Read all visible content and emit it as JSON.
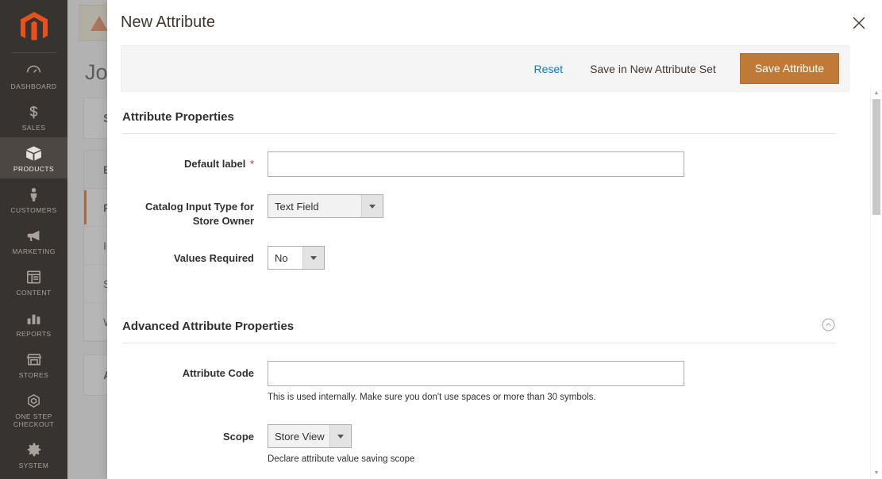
{
  "sidebar": {
    "logo_name": "magento-logo",
    "items": [
      {
        "label": "DASHBOARD",
        "icon": "dashboard-icon",
        "active": false
      },
      {
        "label": "SALES",
        "icon": "dollar-icon",
        "active": false
      },
      {
        "label": "PRODUCTS",
        "icon": "box-icon",
        "active": true
      },
      {
        "label": "CUSTOMERS",
        "icon": "person-icon",
        "active": false
      },
      {
        "label": "MARKETING",
        "icon": "megaphone-icon",
        "active": false
      },
      {
        "label": "CONTENT",
        "icon": "page-layout-icon",
        "active": false
      },
      {
        "label": "REPORTS",
        "icon": "bar-chart-icon",
        "active": false
      },
      {
        "label": "STORES",
        "icon": "storefront-icon",
        "active": false
      },
      {
        "label": "ONE STEP CHECKOUT",
        "icon": "hexagon-icon",
        "active": false
      },
      {
        "label": "SYSTEM",
        "icon": "gear-icon",
        "active": false
      }
    ]
  },
  "background_page": {
    "title": "Jou",
    "banner_icon": "warning-triangle-icon",
    "card_label": "St",
    "accordion_header": "BA",
    "accordion_rows": [
      {
        "label": "P",
        "selected": true
      },
      {
        "label": "In",
        "selected": false
      },
      {
        "label": "S",
        "selected": false
      },
      {
        "label": "W",
        "selected": false
      }
    ],
    "footer_card": "Al"
  },
  "modal": {
    "title": "New Attribute",
    "close_icon": "close-icon",
    "toolbar": {
      "reset_label": "Reset",
      "save_new_set_label": "Save in New Attribute Set",
      "save_label": "Save Attribute"
    },
    "sections": [
      {
        "legend": "Attribute Properties",
        "collapsible": false,
        "fields": [
          {
            "label": "Default label",
            "required": true,
            "control": "text",
            "value": "",
            "placeholder": "",
            "note": ""
          },
          {
            "label": "Catalog Input Type for Store Owner",
            "required": false,
            "control": "select",
            "value": "Text Field",
            "shaded": true,
            "note": ""
          },
          {
            "label": "Values Required",
            "required": false,
            "control": "select",
            "value": "No",
            "shaded": false,
            "note": ""
          }
        ]
      },
      {
        "legend": "Advanced Attribute Properties",
        "collapsible": true,
        "collapse_icon": "chevron-up-circle-icon",
        "fields": [
          {
            "label": "Attribute Code",
            "required": false,
            "control": "text",
            "value": "",
            "placeholder": "",
            "note": "This is used internally. Make sure you don't use spaces or more than 30 symbols."
          },
          {
            "label": "Scope",
            "required": false,
            "control": "select",
            "value": "Store View",
            "shaded": true,
            "note": "Declare attribute value saving scope"
          }
        ]
      }
    ],
    "scrollbar": {
      "up_arrow": "▲",
      "down_arrow": "▼"
    }
  },
  "colors": {
    "accent_orange": "#c07a38",
    "link_blue": "#007bdb",
    "sidebar_bg": "#373330",
    "required_red": "#e22626",
    "magento_orange": "#eb5202"
  }
}
